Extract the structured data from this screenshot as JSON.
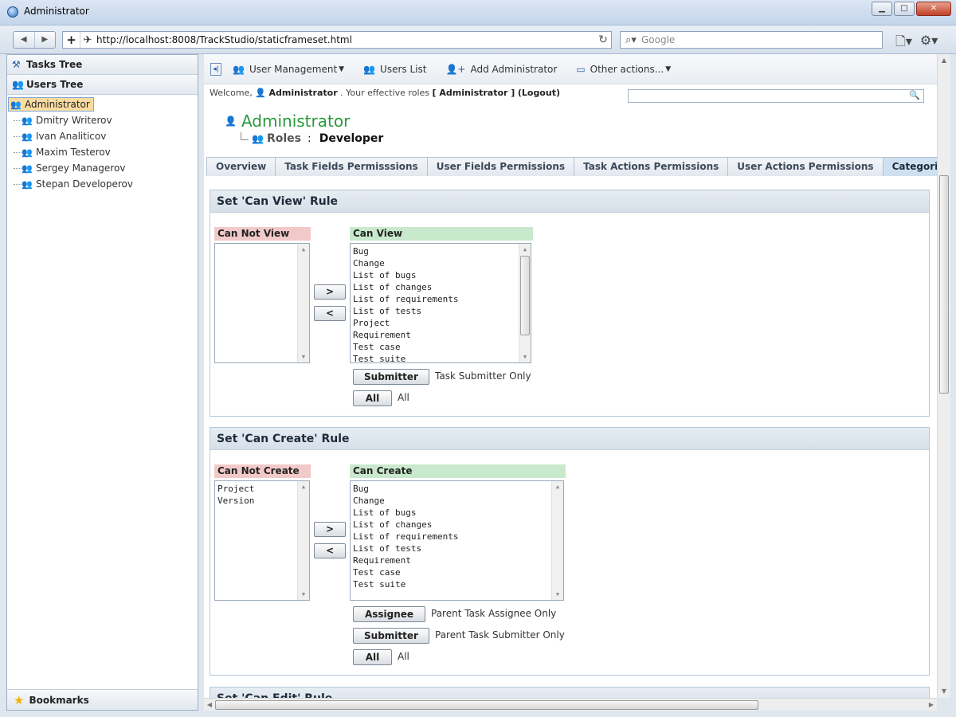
{
  "window": {
    "title": "Administrator"
  },
  "browser": {
    "url": "http://localhost:8008/TrackStudio/staticframeset.html",
    "search_placeholder": "Google"
  },
  "left_panel": {
    "tasks_tree_label": "Tasks Tree",
    "users_tree_label": "Users Tree",
    "root_user": "Administrator",
    "users": [
      "Dmitry Writerov",
      "Ivan Analiticov",
      "Maxim Testerov",
      "Sergey Managerov",
      "Stepan Developerov"
    ],
    "bookmarks_label": "Bookmarks"
  },
  "toolbar": {
    "user_management": "User Management",
    "users_list": "Users List",
    "add_administrator": "Add Administrator",
    "other_actions": "Other actions..."
  },
  "welcome": {
    "prefix": "Welcome,",
    "user": "Administrator",
    "roles_text": ". Your effective roles",
    "roles_value": "[ Administrator ]",
    "logout": "(Logout)"
  },
  "page": {
    "title": "Administrator",
    "roles_label": "Roles",
    "separator": ":",
    "role_value": "Developer"
  },
  "tabs": [
    "Overview",
    "Task Fields Permisssions",
    "User Fields Permissions",
    "Task Actions Permissions",
    "User Actions Permissions",
    "Categories"
  ],
  "can_view": {
    "heading": "Set 'Can View' Rule",
    "left_label": "Can Not View",
    "right_label": "Can View",
    "left_items": [],
    "right_items": [
      "Bug",
      "Change",
      "List of bugs",
      "List of changes",
      "List of requirements",
      "List of tests",
      "Project",
      "Requirement",
      "Test case",
      "Test suite"
    ],
    "move_right": ">",
    "move_left": "<",
    "submitter_btn": "Submitter",
    "submitter_text": "Task Submitter Only",
    "all_btn": "All",
    "all_text": "All"
  },
  "can_create": {
    "heading": "Set 'Can Create' Rule",
    "left_label": "Can Not Create",
    "right_label": "Can Create",
    "left_items": [
      "Project",
      "Version"
    ],
    "right_items": [
      "Bug",
      "Change",
      "List of bugs",
      "List of changes",
      "List of requirements",
      "List of tests",
      "Requirement",
      "Test case",
      "Test suite"
    ],
    "move_right": ">",
    "move_left": "<",
    "assignee_btn": "Assignee",
    "assignee_text": "Parent Task Assignee Only",
    "submitter_btn": "Submitter",
    "submitter_text": "Parent Task Submitter Only",
    "all_btn": "All",
    "all_text": "All"
  },
  "can_edit": {
    "heading": "Set 'Can Edit' Rule"
  }
}
